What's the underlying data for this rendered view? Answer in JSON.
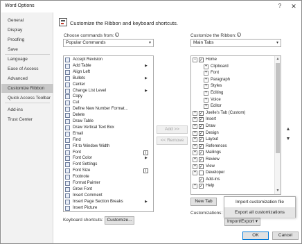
{
  "window": {
    "title": "Word Options",
    "help_glyph": "?",
    "close_glyph": "✕"
  },
  "sidebar": {
    "items": [
      {
        "label": "General"
      },
      {
        "label": "Display"
      },
      {
        "label": "Proofing"
      },
      {
        "label": "Save"
      },
      {
        "label": "Language"
      },
      {
        "label": "Ease of Access"
      },
      {
        "label": "Advanced"
      },
      {
        "label": "Customize Ribbon",
        "selected": true
      },
      {
        "label": "Quick Access Toolbar"
      },
      {
        "label": "Add-ins"
      },
      {
        "label": "Trust Center"
      }
    ]
  },
  "main": {
    "heading": "Customize the Ribbon and keyboard shortcuts.",
    "choose_label": "Choose commands from:",
    "choose_value": "Popular Commands",
    "customize_label": "Customize the Ribbon:",
    "customize_value": "Main Tabs",
    "info_glyph": "i"
  },
  "commands": [
    {
      "label": "Accept Revision"
    },
    {
      "label": "Add Table",
      "submenu": true
    },
    {
      "label": "Align Left"
    },
    {
      "label": "Bullets",
      "submenu": true
    },
    {
      "label": "Center"
    },
    {
      "label": "Change List Level",
      "submenu": true
    },
    {
      "label": "Copy"
    },
    {
      "label": "Cut"
    },
    {
      "label": "Define New Number Format..."
    },
    {
      "label": "Delete"
    },
    {
      "label": "Draw Table"
    },
    {
      "label": "Draw Vertical Text Box"
    },
    {
      "label": "Email"
    },
    {
      "label": "Find"
    },
    {
      "label": "Fit to Window Width"
    },
    {
      "label": "Font",
      "picker": true
    },
    {
      "label": "Font Color",
      "submenu": true
    },
    {
      "label": "Font Settings"
    },
    {
      "label": "Font Size",
      "picker": true
    },
    {
      "label": "Footnote"
    },
    {
      "label": "Format Painter"
    },
    {
      "label": "Grow Font"
    },
    {
      "label": "Insert Comment"
    },
    {
      "label": "Insert Page  Section Breaks",
      "submenu": true
    },
    {
      "label": "Insert Picture"
    }
  ],
  "submenu_glyph": "▶",
  "picker_glyph": "I",
  "tree": [
    {
      "label": "Home",
      "level": 0,
      "expander": "⊟",
      "checked": true
    },
    {
      "label": "Clipboard",
      "level": 1,
      "expander": "⊞"
    },
    {
      "label": "Font",
      "level": 1,
      "expander": "⊞"
    },
    {
      "label": "Paragraph",
      "level": 1,
      "expander": "⊞"
    },
    {
      "label": "Styles",
      "level": 1,
      "expander": "⊞"
    },
    {
      "label": "Editing",
      "level": 1,
      "expander": "⊞"
    },
    {
      "label": "Voice",
      "level": 1,
      "expander": "⊞"
    },
    {
      "label": "Editor",
      "level": 1,
      "expander": "⊞"
    },
    {
      "label": "Joelle's Tab (Custom)",
      "level": 0,
      "expander": "⊞",
      "checked": true
    },
    {
      "label": "Insert",
      "level": 0,
      "expander": "⊞",
      "checked": true
    },
    {
      "label": "Draw",
      "level": 0,
      "expander": "⊞",
      "checked": true
    },
    {
      "label": "Design",
      "level": 0,
      "expander": "⊞",
      "checked": true
    },
    {
      "label": "Layout",
      "level": 0,
      "expander": "⊞",
      "checked": true
    },
    {
      "label": "References",
      "level": 0,
      "expander": "⊞",
      "checked": true
    },
    {
      "label": "Mailings",
      "level": 0,
      "expander": "⊞",
      "checked": true
    },
    {
      "label": "Review",
      "level": 0,
      "expander": "⊞",
      "checked": true
    },
    {
      "label": "View",
      "level": 0,
      "expander": "⊞",
      "checked": true
    },
    {
      "label": "Developer",
      "level": 0,
      "expander": "⊞",
      "checked": false
    },
    {
      "label": "Add-ins",
      "level": 0,
      "expander": "",
      "checked": true
    },
    {
      "label": "Help",
      "level": 0,
      "expander": "⊞",
      "checked": true
    }
  ],
  "check_glyph": "✓",
  "buttons": {
    "add": "Add >>",
    "remove": "<< Remove",
    "new_tab": "New Tab",
    "ok": "OK",
    "cancel": "Cancel",
    "keyboard_customize": "Customize...",
    "import_export": "Import/Export",
    "move_up": "▲",
    "move_down": "▼",
    "scroll_up": "▲",
    "scroll_down": "▼"
  },
  "keyboard_label": "Keyboard shortcuts:",
  "customizations_label": "Customizations:",
  "import_export_menu": {
    "items": [
      {
        "label": "Import customization file"
      },
      {
        "label": "Export all customizations",
        "hover": true
      }
    ]
  },
  "colors": {
    "selection": "#c8c8c8",
    "accent": "#0078d7",
    "sidebar_bg": "#f2f2f2"
  }
}
